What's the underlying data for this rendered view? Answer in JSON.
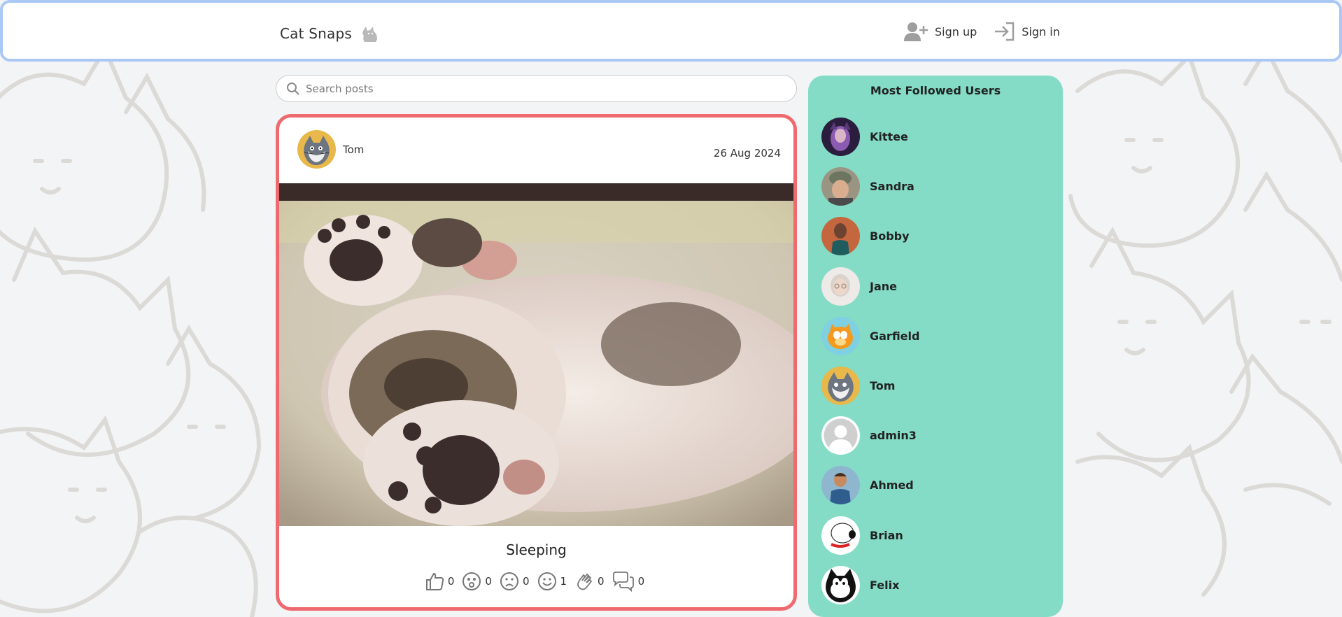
{
  "header": {
    "brand": "Cat Snaps",
    "sign_up": "Sign up",
    "sign_in": "Sign in"
  },
  "search": {
    "placeholder": "Search posts",
    "value": ""
  },
  "post": {
    "author": "Tom",
    "date": "26 Aug 2024",
    "title": "Sleeping",
    "reactions": [
      {
        "icon": "thumbs-up-icon",
        "count": "0"
      },
      {
        "icon": "surprised-icon",
        "count": "0"
      },
      {
        "icon": "sad-face-icon",
        "count": "0"
      },
      {
        "icon": "happy-face-icon",
        "count": "1"
      },
      {
        "icon": "clap-icon",
        "count": "0"
      },
      {
        "icon": "comments-icon",
        "count": "0"
      }
    ]
  },
  "sidebar": {
    "title": "Most Followed Users",
    "users": [
      {
        "name": "Kittee",
        "color": "#5b3a7a"
      },
      {
        "name": "Sandra",
        "color": "#7d7868"
      },
      {
        "name": "Bobby",
        "color": "#c4673f"
      },
      {
        "name": "Jane",
        "color": "#e7e4e2"
      },
      {
        "name": "Garfield",
        "color": "#f39a1f"
      },
      {
        "name": "Tom",
        "color": "#e8b84a"
      },
      {
        "name": "admin3",
        "color": "#d6d6d6"
      },
      {
        "name": "Ahmed",
        "color": "#3d6f9e"
      },
      {
        "name": "Brian",
        "color": "#ffffff"
      },
      {
        "name": "Felix",
        "color": "#ffffff"
      }
    ]
  },
  "colors": {
    "header_border": "#a9c8f5",
    "post_border": "#ee6a6f",
    "sidebar_bg": "#84dcc6"
  }
}
